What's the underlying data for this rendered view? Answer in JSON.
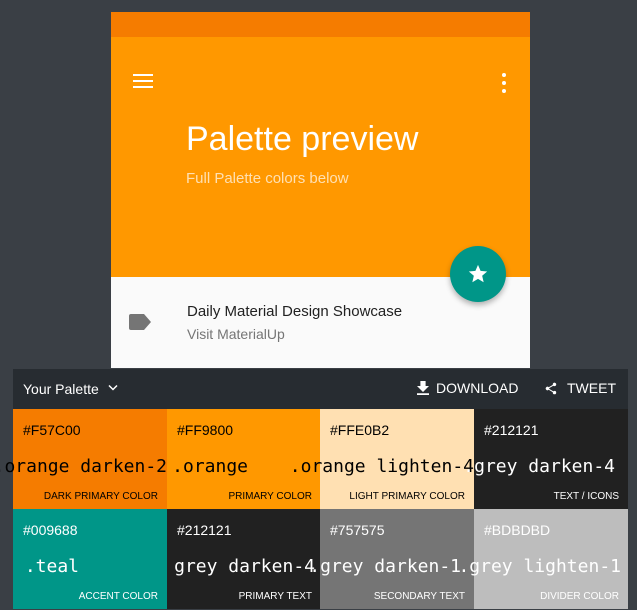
{
  "colors": {
    "primary": "#FF9800",
    "primary_dark": "#F57C00",
    "accent": "#009688",
    "background": "#3A3F45",
    "panel_toolbar": "#272C31"
  },
  "preview": {
    "title": "Palette preview",
    "subtitle": "Full Palette colors below",
    "fab_icon": "star-icon",
    "list_item": {
      "title": "Daily Material Design Showcase",
      "subtitle": "Visit MaterialUp",
      "icon": "label-icon"
    }
  },
  "toolbar": {
    "palette_label": "Your Palette",
    "download_label": "DOWNLOAD",
    "tweet_label": "TWEET"
  },
  "swatches": [
    {
      "hex": "#F57C00",
      "name": ".orange darken-2",
      "role": "DARK PRIMARY COLOR"
    },
    {
      "hex": "#FF9800",
      "name": ".orange",
      "role": "PRIMARY COLOR"
    },
    {
      "hex": "#FFE0B2",
      "name": ".orange lighten-4",
      "role": "LIGHT PRIMARY COLOR"
    },
    {
      "hex": "#212121",
      "name": ".grey darken-4",
      "role": "TEXT / ICONS"
    },
    {
      "hex": "#009688",
      "name": ".teal",
      "role": "ACCENT COLOR"
    },
    {
      "hex": "#212121",
      "name": "grey darken-4",
      "role": "PRIMARY TEXT"
    },
    {
      "hex": "#757575",
      "name": ".grey darken-1",
      "role": "SECONDARY TEXT"
    },
    {
      "hex": "#BDBDBD",
      "name": ".grey lighten-1",
      "role": "DIVIDER COLOR"
    }
  ]
}
